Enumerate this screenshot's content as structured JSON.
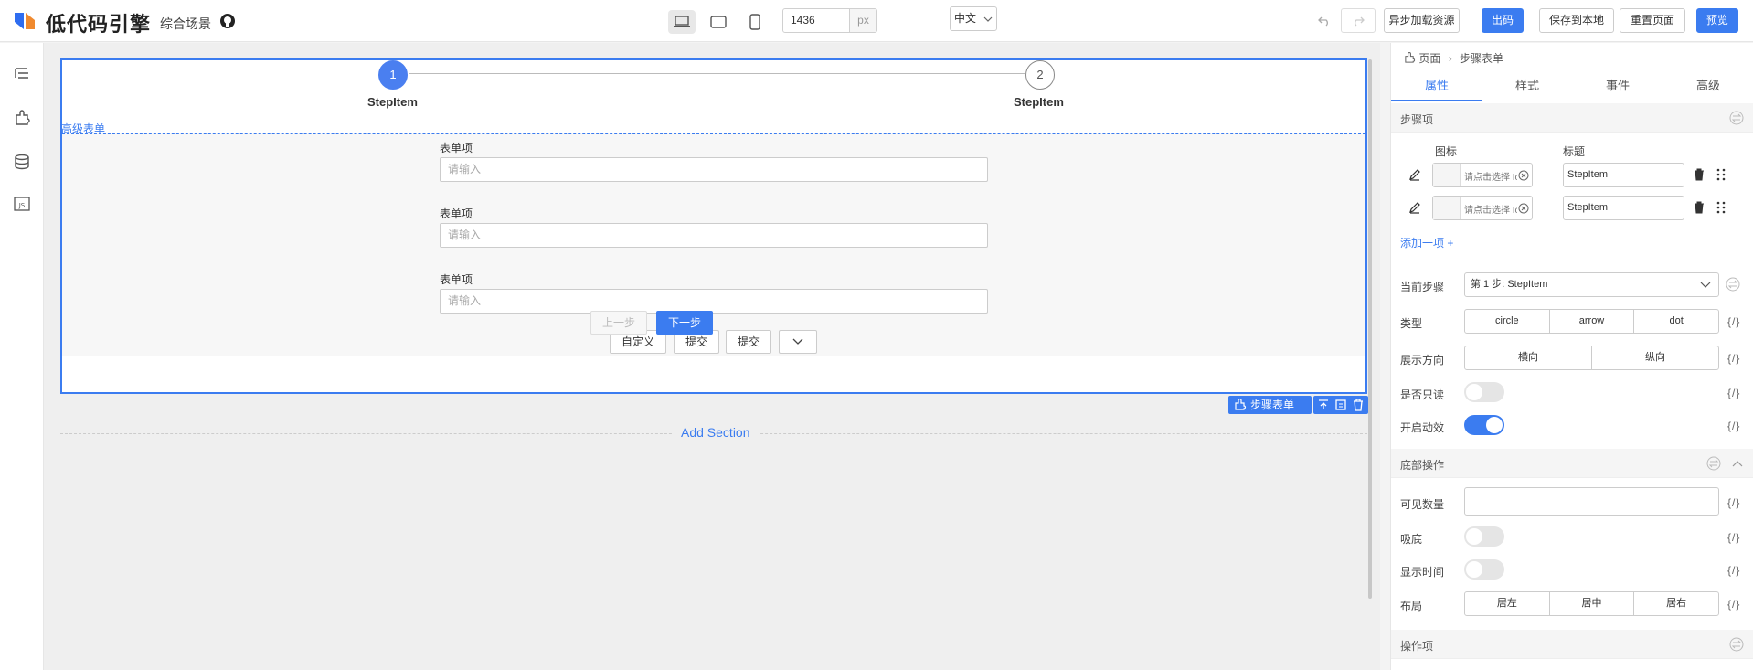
{
  "app": {
    "brand": "低代码引擎",
    "scene": "综合场景"
  },
  "toolbar": {
    "width_value": "1436",
    "width_unit": "px",
    "language": "中文",
    "async_load": "异步加载资源",
    "export": "出码",
    "save_local": "保存到本地",
    "reset_page": "重置页面",
    "preview": "预览"
  },
  "canvas": {
    "steps": [
      {
        "number": "1",
        "title": "StepItem"
      },
      {
        "number": "2",
        "title": "StepItem"
      }
    ],
    "advanced_form_label": "高级表单",
    "form_items": [
      {
        "label": "表单项",
        "placeholder": "请输入"
      },
      {
        "label": "表单项",
        "placeholder": "请输入"
      },
      {
        "label": "表单项",
        "placeholder": "请输入"
      }
    ],
    "form_buttons": [
      "自定义",
      "提交",
      "提交"
    ],
    "prev": "上一步",
    "next": "下一步",
    "component_tag": "步骤表单",
    "add_section": "Add Section"
  },
  "panel": {
    "breadcrumb": [
      "页面",
      "步骤表单"
    ],
    "tabs": [
      "属性",
      "样式",
      "事件",
      "高级"
    ],
    "sections": {
      "step_items": "步骤项",
      "footer_ops": "底部操作",
      "actions": "操作项"
    },
    "col_icon": "图标",
    "col_title": "标题",
    "step_rows": [
      {
        "icon_placeholder": "请点击选择 Ico",
        "title": "StepItem"
      },
      {
        "icon_placeholder": "请点击选择 Ico",
        "title": "StepItem"
      }
    ],
    "add_item": "添加一项 +",
    "props": {
      "current_step_label": "当前步骤",
      "current_step_value": "第 1 步: StepItem",
      "type_label": "类型",
      "type_options": [
        "circle",
        "arrow",
        "dot"
      ],
      "direction_label": "展示方向",
      "direction_options": [
        "横向",
        "纵向"
      ],
      "readonly_label": "是否只读",
      "animation_label": "开启动效",
      "visible_count_label": "可见数量",
      "sticky_label": "吸底",
      "show_time_label": "显示时间",
      "layout_label": "布局",
      "layout_options": [
        "居左",
        "居中",
        "居右"
      ],
      "bind": "{/}"
    },
    "toggles": {
      "readonly": false,
      "animation": true,
      "sticky": false,
      "show_time": false
    }
  }
}
